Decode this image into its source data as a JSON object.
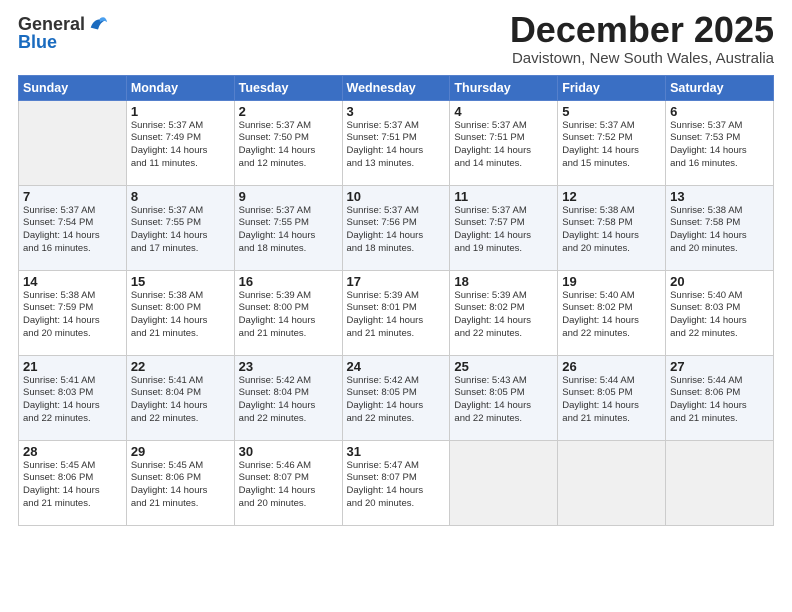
{
  "header": {
    "logo_general": "General",
    "logo_blue": "Blue",
    "month": "December 2025",
    "location": "Davistown, New South Wales, Australia"
  },
  "days_of_week": [
    "Sunday",
    "Monday",
    "Tuesday",
    "Wednesday",
    "Thursday",
    "Friday",
    "Saturday"
  ],
  "weeks": [
    [
      {
        "day": "",
        "info": ""
      },
      {
        "day": "1",
        "info": "Sunrise: 5:37 AM\nSunset: 7:49 PM\nDaylight: 14 hours\nand 11 minutes."
      },
      {
        "day": "2",
        "info": "Sunrise: 5:37 AM\nSunset: 7:50 PM\nDaylight: 14 hours\nand 12 minutes."
      },
      {
        "day": "3",
        "info": "Sunrise: 5:37 AM\nSunset: 7:51 PM\nDaylight: 14 hours\nand 13 minutes."
      },
      {
        "day": "4",
        "info": "Sunrise: 5:37 AM\nSunset: 7:51 PM\nDaylight: 14 hours\nand 14 minutes."
      },
      {
        "day": "5",
        "info": "Sunrise: 5:37 AM\nSunset: 7:52 PM\nDaylight: 14 hours\nand 15 minutes."
      },
      {
        "day": "6",
        "info": "Sunrise: 5:37 AM\nSunset: 7:53 PM\nDaylight: 14 hours\nand 16 minutes."
      }
    ],
    [
      {
        "day": "7",
        "info": "Sunrise: 5:37 AM\nSunset: 7:54 PM\nDaylight: 14 hours\nand 16 minutes."
      },
      {
        "day": "8",
        "info": "Sunrise: 5:37 AM\nSunset: 7:55 PM\nDaylight: 14 hours\nand 17 minutes."
      },
      {
        "day": "9",
        "info": "Sunrise: 5:37 AM\nSunset: 7:55 PM\nDaylight: 14 hours\nand 18 minutes."
      },
      {
        "day": "10",
        "info": "Sunrise: 5:37 AM\nSunset: 7:56 PM\nDaylight: 14 hours\nand 18 minutes."
      },
      {
        "day": "11",
        "info": "Sunrise: 5:37 AM\nSunset: 7:57 PM\nDaylight: 14 hours\nand 19 minutes."
      },
      {
        "day": "12",
        "info": "Sunrise: 5:38 AM\nSunset: 7:58 PM\nDaylight: 14 hours\nand 20 minutes."
      },
      {
        "day": "13",
        "info": "Sunrise: 5:38 AM\nSunset: 7:58 PM\nDaylight: 14 hours\nand 20 minutes."
      }
    ],
    [
      {
        "day": "14",
        "info": "Sunrise: 5:38 AM\nSunset: 7:59 PM\nDaylight: 14 hours\nand 20 minutes."
      },
      {
        "day": "15",
        "info": "Sunrise: 5:38 AM\nSunset: 8:00 PM\nDaylight: 14 hours\nand 21 minutes."
      },
      {
        "day": "16",
        "info": "Sunrise: 5:39 AM\nSunset: 8:00 PM\nDaylight: 14 hours\nand 21 minutes."
      },
      {
        "day": "17",
        "info": "Sunrise: 5:39 AM\nSunset: 8:01 PM\nDaylight: 14 hours\nand 21 minutes."
      },
      {
        "day": "18",
        "info": "Sunrise: 5:39 AM\nSunset: 8:02 PM\nDaylight: 14 hours\nand 22 minutes."
      },
      {
        "day": "19",
        "info": "Sunrise: 5:40 AM\nSunset: 8:02 PM\nDaylight: 14 hours\nand 22 minutes."
      },
      {
        "day": "20",
        "info": "Sunrise: 5:40 AM\nSunset: 8:03 PM\nDaylight: 14 hours\nand 22 minutes."
      }
    ],
    [
      {
        "day": "21",
        "info": "Sunrise: 5:41 AM\nSunset: 8:03 PM\nDaylight: 14 hours\nand 22 minutes."
      },
      {
        "day": "22",
        "info": "Sunrise: 5:41 AM\nSunset: 8:04 PM\nDaylight: 14 hours\nand 22 minutes."
      },
      {
        "day": "23",
        "info": "Sunrise: 5:42 AM\nSunset: 8:04 PM\nDaylight: 14 hours\nand 22 minutes."
      },
      {
        "day": "24",
        "info": "Sunrise: 5:42 AM\nSunset: 8:05 PM\nDaylight: 14 hours\nand 22 minutes."
      },
      {
        "day": "25",
        "info": "Sunrise: 5:43 AM\nSunset: 8:05 PM\nDaylight: 14 hours\nand 22 minutes."
      },
      {
        "day": "26",
        "info": "Sunrise: 5:44 AM\nSunset: 8:05 PM\nDaylight: 14 hours\nand 21 minutes."
      },
      {
        "day": "27",
        "info": "Sunrise: 5:44 AM\nSunset: 8:06 PM\nDaylight: 14 hours\nand 21 minutes."
      }
    ],
    [
      {
        "day": "28",
        "info": "Sunrise: 5:45 AM\nSunset: 8:06 PM\nDaylight: 14 hours\nand 21 minutes."
      },
      {
        "day": "29",
        "info": "Sunrise: 5:45 AM\nSunset: 8:06 PM\nDaylight: 14 hours\nand 21 minutes."
      },
      {
        "day": "30",
        "info": "Sunrise: 5:46 AM\nSunset: 8:07 PM\nDaylight: 14 hours\nand 20 minutes."
      },
      {
        "day": "31",
        "info": "Sunrise: 5:47 AM\nSunset: 8:07 PM\nDaylight: 14 hours\nand 20 minutes."
      },
      {
        "day": "",
        "info": ""
      },
      {
        "day": "",
        "info": ""
      },
      {
        "day": "",
        "info": ""
      }
    ]
  ]
}
